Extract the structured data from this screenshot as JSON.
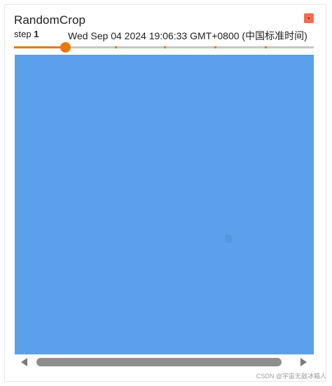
{
  "card": {
    "title": "RandomCrop",
    "step_label": "step",
    "step_value": "1",
    "timestamp": "Wed Sep 04 2024 19:06:33 GMT+0800 (中国标准时间)",
    "slider": {
      "progress": 0.17,
      "tick_positions": [
        0.336,
        0.5,
        0.668,
        0.836
      ]
    },
    "image": {
      "color": "#5aa0ea"
    }
  },
  "colors": {
    "accent": "#e8780e",
    "expand_button": "#f06d4f"
  },
  "watermark": "CSDN @宇宙无敌冰箱人"
}
